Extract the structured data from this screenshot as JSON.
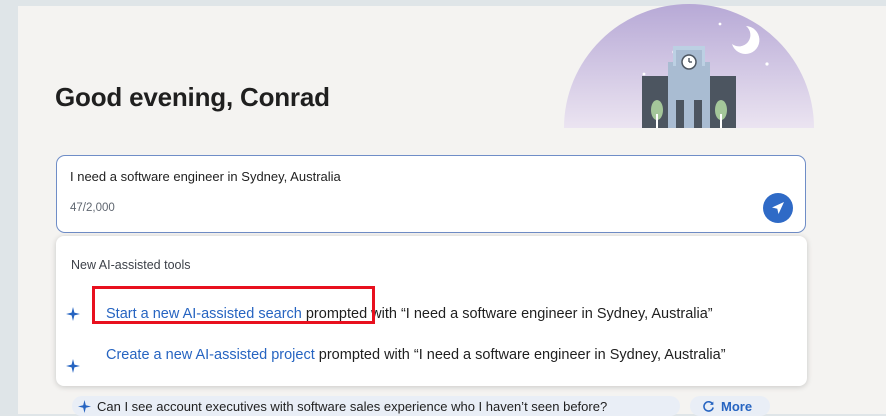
{
  "greeting": "Good evening, Conrad",
  "prompt": {
    "text": "I need a software engineer in Sydney, Australia",
    "char_count": "47/2,000"
  },
  "dropdown": {
    "heading": "New AI-assisted tools",
    "items": [
      {
        "link": "Start a new AI-assisted search",
        "rest": " prompted with “I need a software engineer in Sydney, Australia”",
        "icon": "sparkle-icon"
      },
      {
        "link": "Create a new AI-assisted project",
        "rest": " prompted with “I need a software engineer in Sydney, Australia”",
        "icon": "sparkle-icon"
      }
    ]
  },
  "suggestions": {
    "chip": "Can I see account executives with software sales experience who I haven’t seen before?",
    "more": "More"
  },
  "colors": {
    "accent": "#2f6ac6",
    "link": "#2664c1",
    "highlight": "#e8101e"
  }
}
